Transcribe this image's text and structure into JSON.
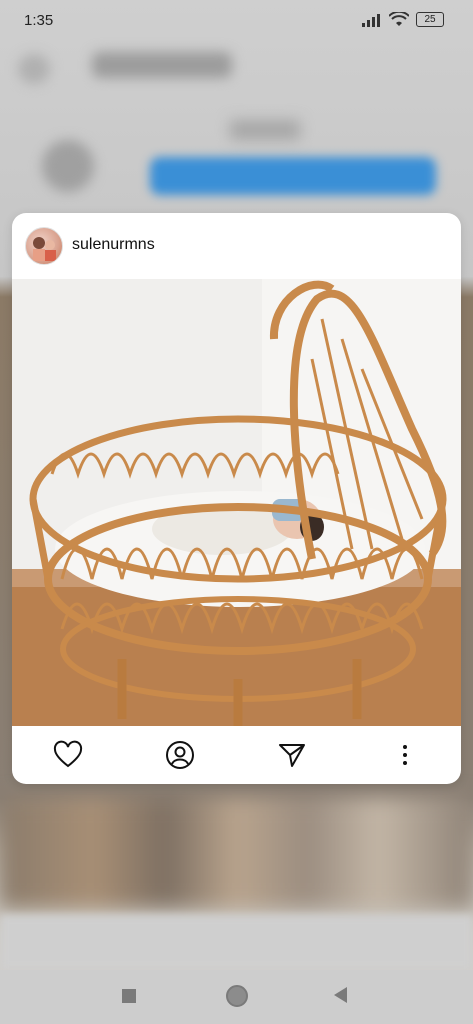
{
  "status_bar": {
    "time": "1:35",
    "battery": "25"
  },
  "post_preview": {
    "username": "sulenurmns",
    "image_alt": "Baby sleeping in a rattan bassinet"
  },
  "actions": [
    "like-icon",
    "profile-icon",
    "share-icon",
    "more-icon"
  ],
  "colors": {
    "card_bg": "#ffffff",
    "rattan": "#c98a4b",
    "blur_button": "#3a8fd6"
  }
}
